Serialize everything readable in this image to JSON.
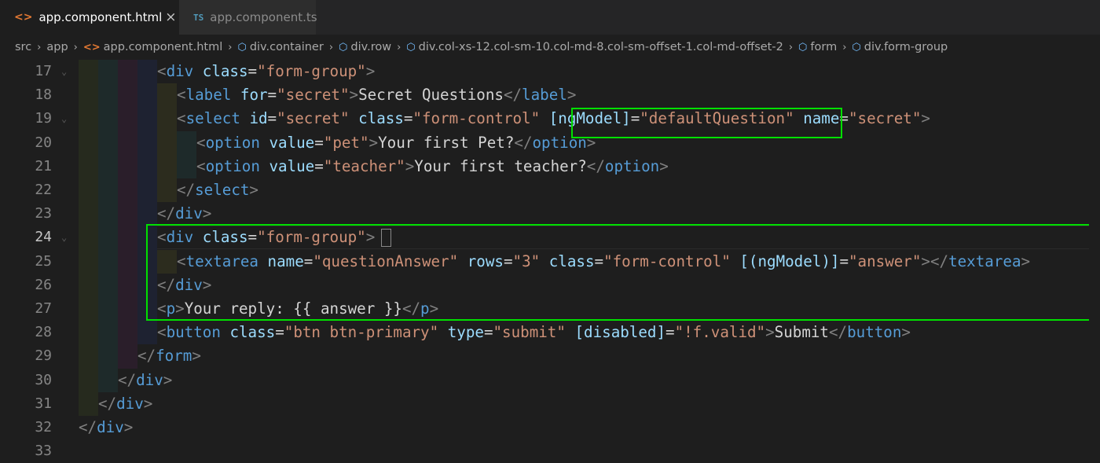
{
  "tabs": [
    {
      "label": "app.component.html",
      "icon": "html-file-icon",
      "active": true
    },
    {
      "label": "app.component.ts",
      "icon": "ts-file-icon",
      "active": false
    }
  ],
  "tab_icons": {
    "html": "<>",
    "ts": "TS",
    "close": "×"
  },
  "breadcrumb": [
    {
      "label": "src",
      "icon": ""
    },
    {
      "label": "app",
      "icon": ""
    },
    {
      "label": "app.component.html",
      "icon": "html"
    },
    {
      "label": "div.container",
      "icon": "cube"
    },
    {
      "label": "div.row",
      "icon": "cube"
    },
    {
      "label": "div.col-xs-12.col-sm-10.col-md-8.col-sm-offset-1.col-md-offset-2",
      "icon": "cube"
    },
    {
      "label": "form",
      "icon": "cube"
    },
    {
      "label": "div.form-group",
      "icon": "cube"
    }
  ],
  "colors": {
    "background": "#1e1e1e",
    "tag": "#569cd6",
    "attribute": "#9cdcfe",
    "string": "#ce9178",
    "highlight_box": "#00e000"
  },
  "current_line": 24,
  "lines": [
    {
      "n": "17",
      "indent": 4,
      "fold": true,
      "tokens": [
        [
          "t",
          "<"
        ],
        [
          "tag",
          "div"
        ],
        [
          "txt",
          " "
        ],
        [
          "attr",
          "class"
        ],
        [
          "txt",
          "="
        ],
        [
          "str",
          "\"form-group\""
        ],
        [
          "t",
          ">"
        ]
      ]
    },
    {
      "n": "18",
      "indent": 5,
      "fold": false,
      "tokens": [
        [
          "t",
          "<"
        ],
        [
          "tag",
          "label"
        ],
        [
          "txt",
          " "
        ],
        [
          "attr",
          "for"
        ],
        [
          "txt",
          "="
        ],
        [
          "str",
          "\"secret\""
        ],
        [
          "t",
          ">"
        ],
        [
          "txt",
          "Secret Questions"
        ],
        [
          "t",
          "</"
        ],
        [
          "tag",
          "label"
        ],
        [
          "t",
          ">"
        ]
      ]
    },
    {
      "n": "19",
      "indent": 5,
      "fold": true,
      "tokens": [
        [
          "t",
          "<"
        ],
        [
          "tag",
          "select"
        ],
        [
          "txt",
          " "
        ],
        [
          "attr",
          "id"
        ],
        [
          "txt",
          "="
        ],
        [
          "str",
          "\"secret\""
        ],
        [
          "txt",
          " "
        ],
        [
          "attr",
          "class"
        ],
        [
          "txt",
          "="
        ],
        [
          "str",
          "\"form-control\""
        ],
        [
          "txt",
          " "
        ],
        [
          "attr",
          "[ngModel]"
        ],
        [
          "txt",
          "="
        ],
        [
          "str",
          "\"defaultQuestion\""
        ],
        [
          "txt",
          " "
        ],
        [
          "attr",
          "name"
        ],
        [
          "txt",
          "="
        ],
        [
          "str",
          "\"secret\""
        ],
        [
          "t",
          ">"
        ]
      ]
    },
    {
      "n": "20",
      "indent": 6,
      "fold": false,
      "tokens": [
        [
          "t",
          "<"
        ],
        [
          "tag",
          "option"
        ],
        [
          "txt",
          " "
        ],
        [
          "attr",
          "value"
        ],
        [
          "txt",
          "="
        ],
        [
          "str",
          "\"pet\""
        ],
        [
          "t",
          ">"
        ],
        [
          "txt",
          "Your first Pet?"
        ],
        [
          "t",
          "</"
        ],
        [
          "tag",
          "option"
        ],
        [
          "t",
          ">"
        ]
      ]
    },
    {
      "n": "21",
      "indent": 6,
      "fold": false,
      "tokens": [
        [
          "t",
          "<"
        ],
        [
          "tag",
          "option"
        ],
        [
          "txt",
          " "
        ],
        [
          "attr",
          "value"
        ],
        [
          "txt",
          "="
        ],
        [
          "str",
          "\"teacher\""
        ],
        [
          "t",
          ">"
        ],
        [
          "txt",
          "Your first teacher?"
        ],
        [
          "t",
          "</"
        ],
        [
          "tag",
          "option"
        ],
        [
          "t",
          ">"
        ]
      ]
    },
    {
      "n": "22",
      "indent": 5,
      "fold": false,
      "tokens": [
        [
          "t",
          "</"
        ],
        [
          "tag",
          "select"
        ],
        [
          "t",
          ">"
        ]
      ]
    },
    {
      "n": "23",
      "indent": 4,
      "fold": false,
      "tokens": [
        [
          "t",
          "</"
        ],
        [
          "tag",
          "div"
        ],
        [
          "t",
          ">"
        ]
      ]
    },
    {
      "n": "24",
      "indent": 4,
      "fold": true,
      "tokens": [
        [
          "t",
          "<"
        ],
        [
          "tag",
          "div"
        ],
        [
          "txt",
          " "
        ],
        [
          "attr",
          "class"
        ],
        [
          "txt",
          "="
        ],
        [
          "str",
          "\"form-group\""
        ],
        [
          "t",
          ">"
        ]
      ]
    },
    {
      "n": "25",
      "indent": 5,
      "fold": false,
      "tokens": [
        [
          "t",
          "<"
        ],
        [
          "tag",
          "textarea"
        ],
        [
          "txt",
          " "
        ],
        [
          "attr",
          "name"
        ],
        [
          "txt",
          "="
        ],
        [
          "str",
          "\"questionAnswer\""
        ],
        [
          "txt",
          " "
        ],
        [
          "attr",
          "rows"
        ],
        [
          "txt",
          "="
        ],
        [
          "str",
          "\"3\""
        ],
        [
          "txt",
          " "
        ],
        [
          "attr",
          "class"
        ],
        [
          "txt",
          "="
        ],
        [
          "str",
          "\"form-control\""
        ],
        [
          "txt",
          " "
        ],
        [
          "attr",
          "[(ngModel)]"
        ],
        [
          "txt",
          "="
        ],
        [
          "str",
          "\"answer\""
        ],
        [
          "t",
          "></"
        ],
        [
          "tag",
          "textarea"
        ],
        [
          "t",
          ">"
        ]
      ]
    },
    {
      "n": "26",
      "indent": 4,
      "fold": false,
      "tokens": [
        [
          "t",
          "</"
        ],
        [
          "tag",
          "div"
        ],
        [
          "t",
          ">"
        ]
      ]
    },
    {
      "n": "27",
      "indent": 4,
      "fold": false,
      "tokens": [
        [
          "t",
          "<"
        ],
        [
          "tag",
          "p"
        ],
        [
          "t",
          ">"
        ],
        [
          "txt",
          "Your reply: {{ answer }}"
        ],
        [
          "t",
          "</"
        ],
        [
          "tag",
          "p"
        ],
        [
          "t",
          ">"
        ]
      ]
    },
    {
      "n": "28",
      "indent": 4,
      "fold": false,
      "tokens": [
        [
          "t",
          "<"
        ],
        [
          "tag",
          "button"
        ],
        [
          "txt",
          " "
        ],
        [
          "attr",
          "class"
        ],
        [
          "txt",
          "="
        ],
        [
          "str",
          "\"btn btn-primary\""
        ],
        [
          "txt",
          " "
        ],
        [
          "attr",
          "type"
        ],
        [
          "txt",
          "="
        ],
        [
          "str",
          "\"submit\""
        ],
        [
          "txt",
          " "
        ],
        [
          "attr",
          "[disabled]"
        ],
        [
          "txt",
          "="
        ],
        [
          "str",
          "\"!f.valid\""
        ],
        [
          "t",
          ">"
        ],
        [
          "txt",
          "Submit"
        ],
        [
          "t",
          "</"
        ],
        [
          "tag",
          "button"
        ],
        [
          "t",
          ">"
        ]
      ]
    },
    {
      "n": "29",
      "indent": 3,
      "fold": false,
      "tokens": [
        [
          "t",
          "</"
        ],
        [
          "tag",
          "form"
        ],
        [
          "t",
          ">"
        ]
      ]
    },
    {
      "n": "30",
      "indent": 2,
      "fold": false,
      "tokens": [
        [
          "t",
          "</"
        ],
        [
          "tag",
          "div"
        ],
        [
          "t",
          ">"
        ]
      ]
    },
    {
      "n": "31",
      "indent": 1,
      "fold": false,
      "tokens": [
        [
          "t",
          "</"
        ],
        [
          "tag",
          "div"
        ],
        [
          "t",
          ">"
        ]
      ]
    },
    {
      "n": "32",
      "indent": 0,
      "fold": false,
      "tokens": [
        [
          "t",
          "</"
        ],
        [
          "tag",
          "div"
        ],
        [
          "t",
          ">"
        ]
      ]
    },
    {
      "n": "33",
      "indent": 0,
      "fold": false,
      "tokens": []
    }
  ]
}
